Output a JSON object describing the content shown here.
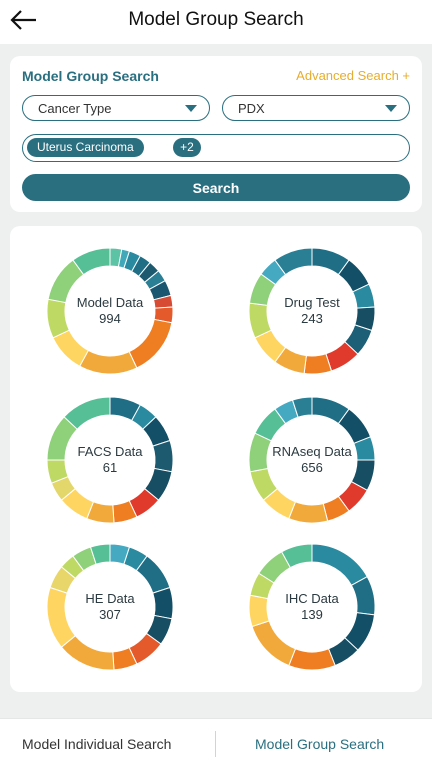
{
  "header": {
    "title": "Model Group Search",
    "back_icon": "arrow-left-icon"
  },
  "search": {
    "card_title": "Model Group Search",
    "advanced_label": "Advanced Search +",
    "cancer_type_select": "Cancer Type",
    "model_type_select": "PDX",
    "selected_tag": "Uterus Carcinoma",
    "more_tags": "+2",
    "search_button": "Search",
    "colors": {
      "primary": "#2a6f80",
      "accent": "#e7ad2c"
    }
  },
  "charts": [
    {
      "label": "Model Data",
      "count": "994",
      "segments": [
        [
          "#5dc3a5",
          0.03
        ],
        [
          "#41a8ba",
          0.02
        ],
        [
          "#2a8aa0",
          0.03
        ],
        [
          "#1f6e86",
          0.03
        ],
        [
          "#1d5a70",
          0.03
        ],
        [
          "#2a7f95",
          0.03
        ],
        [
          "#1a5670",
          0.04
        ],
        [
          "#d74a33",
          0.03
        ],
        [
          "#e45a2a",
          0.04
        ],
        [
          "#ef7d22",
          0.15
        ],
        [
          "#f2a93b",
          0.15
        ],
        [
          "#ffd561",
          0.1
        ],
        [
          "#bfd965",
          0.1
        ],
        [
          "#8fd07a",
          0.12
        ],
        [
          "#57bf95",
          0.1
        ]
      ]
    },
    {
      "label": "Drug Test",
      "count": "243",
      "segments": [
        [
          "#1f6e86",
          0.1
        ],
        [
          "#134f66",
          0.08
        ],
        [
          "#2a8aa0",
          0.06
        ],
        [
          "#174e63",
          0.06
        ],
        [
          "#1c5f76",
          0.07
        ],
        [
          "#e03a2c",
          0.08
        ],
        [
          "#ef7d22",
          0.07
        ],
        [
          "#f2a93b",
          0.08
        ],
        [
          "#ffd561",
          0.08
        ],
        [
          "#bfd965",
          0.09
        ],
        [
          "#8fd07a",
          0.08
        ],
        [
          "#46a9c2",
          0.05
        ],
        [
          "#2a7f95",
          0.1
        ]
      ]
    },
    {
      "label": "FACS Data",
      "count": "61",
      "segments": [
        [
          "#1f6e86",
          0.08
        ],
        [
          "#2a8aa0",
          0.05
        ],
        [
          "#134f66",
          0.07
        ],
        [
          "#1d5a70",
          0.08
        ],
        [
          "#174e63",
          0.08
        ],
        [
          "#e03a2c",
          0.07
        ],
        [
          "#ef7d22",
          0.06
        ],
        [
          "#f2a93b",
          0.07
        ],
        [
          "#ffd561",
          0.08
        ],
        [
          "#e3d66a",
          0.05
        ],
        [
          "#bfd965",
          0.06
        ],
        [
          "#8fd07a",
          0.12
        ],
        [
          "#57bf95",
          0.13
        ]
      ]
    },
    {
      "label": "RNAseq Data",
      "count": "656",
      "segments": [
        [
          "#1f6e86",
          0.1
        ],
        [
          "#134f66",
          0.09
        ],
        [
          "#2a8aa0",
          0.06
        ],
        [
          "#174e63",
          0.08
        ],
        [
          "#e03a2c",
          0.07
        ],
        [
          "#ef7d22",
          0.06
        ],
        [
          "#f2a93b",
          0.1
        ],
        [
          "#ffd561",
          0.08
        ],
        [
          "#bfd965",
          0.08
        ],
        [
          "#8fd07a",
          0.1
        ],
        [
          "#57bf95",
          0.08
        ],
        [
          "#46a9c2",
          0.05
        ],
        [
          "#2a7f95",
          0.05
        ]
      ]
    },
    {
      "label": "HE Data",
      "count": "307",
      "segments": [
        [
          "#46a9c2",
          0.05
        ],
        [
          "#2a8aa0",
          0.05
        ],
        [
          "#1f6e86",
          0.1
        ],
        [
          "#134f66",
          0.08
        ],
        [
          "#174e63",
          0.07
        ],
        [
          "#e45a2a",
          0.08
        ],
        [
          "#ef7d22",
          0.06
        ],
        [
          "#f2a93b",
          0.15
        ],
        [
          "#ffd561",
          0.16
        ],
        [
          "#e8d66a",
          0.06
        ],
        [
          "#bfd965",
          0.04
        ],
        [
          "#8fd07a",
          0.05
        ],
        [
          "#57bf95",
          0.05
        ]
      ]
    },
    {
      "label": "IHC Data",
      "count": "139",
      "segments": [
        [
          "#2a8aa0",
          0.17
        ],
        [
          "#1f6e86",
          0.1
        ],
        [
          "#134f66",
          0.1
        ],
        [
          "#174e63",
          0.07
        ],
        [
          "#ef7d22",
          0.12
        ],
        [
          "#f2a93b",
          0.14
        ],
        [
          "#ffd561",
          0.08
        ],
        [
          "#bfd965",
          0.06
        ],
        [
          "#8fd07a",
          0.08
        ],
        [
          "#57bf95",
          0.08
        ]
      ]
    }
  ],
  "bottom_tabs": {
    "individual": "Model Individual Search",
    "group": "Model Group Search"
  }
}
